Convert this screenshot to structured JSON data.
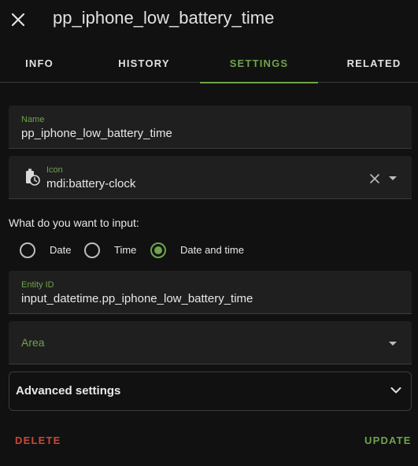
{
  "dialog": {
    "title": "pp_iphone_low_battery_time",
    "close_icon": "close-icon"
  },
  "tabs": [
    {
      "label": "INFO",
      "active": false
    },
    {
      "label": "HISTORY",
      "active": false
    },
    {
      "label": "SETTINGS",
      "active": true
    },
    {
      "label": "RELATED",
      "active": false
    }
  ],
  "form": {
    "name": {
      "label": "Name",
      "value": "pp_iphone_low_battery_time"
    },
    "icon": {
      "label": "Icon",
      "value": "mdi:battery-clock",
      "icon_name": "battery-clock-icon"
    },
    "input_question": "What do you want to input:",
    "input_options": [
      {
        "label": "Date",
        "checked": false
      },
      {
        "label": "Time",
        "checked": false
      },
      {
        "label": "Date and time",
        "checked": true
      }
    ],
    "entity_id": {
      "label": "Entity ID",
      "value": "input_datetime.pp_iphone_low_battery_time"
    },
    "area": {
      "placeholder": "Area"
    },
    "advanced_settings": "Advanced settings"
  },
  "actions": {
    "delete": "DELETE",
    "update": "UPDATE"
  },
  "colors": {
    "accent": "#6ea44a",
    "danger": "#c8483b",
    "background": "#111111",
    "field_background": "#1f1f1f"
  }
}
